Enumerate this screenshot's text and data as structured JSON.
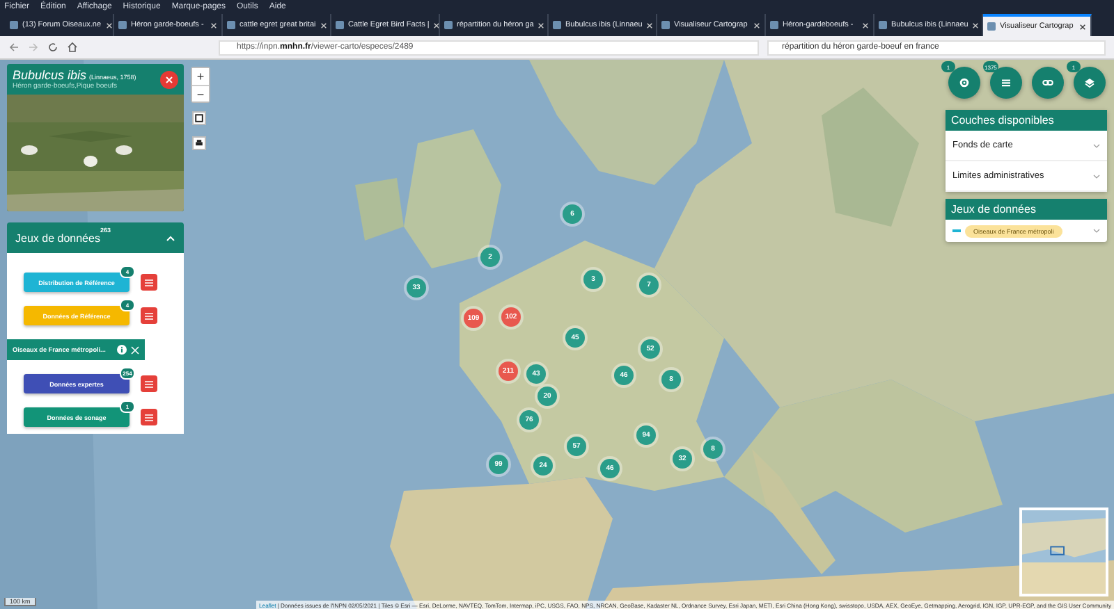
{
  "menu_bar": {
    "items": [
      "Fichier",
      "Édition",
      "Affichage",
      "Historique",
      "Marque-pages",
      "Outils",
      "Aide"
    ]
  },
  "tabs": [
    {
      "title": "(13) Forum Oiseaux.ne",
      "selected": false
    },
    {
      "title": "Héron garde-boeufs - ",
      "selected": false
    },
    {
      "title": "cattle egret great britai",
      "selected": false
    },
    {
      "title": "Cattle Egret Bird Facts |",
      "selected": false
    },
    {
      "title": "répartition du héron ga",
      "selected": false
    },
    {
      "title": "Bubulcus ibis (Linnaeu",
      "selected": false
    },
    {
      "title": "Visualiseur Cartograp",
      "selected": false
    },
    {
      "title": "Héron-gardeboeufs - ",
      "selected": false
    },
    {
      "title": "Bubulcus ibis (Linnaeu",
      "selected": false
    },
    {
      "title": "Visualiseur Cartograp",
      "selected": true
    }
  ],
  "toolbar": {
    "url": "https://inpn.**mnhn.fr**/viewer-carto/especes/2489",
    "search": "répartition du héron garde-boeuf en france"
  },
  "species_card": {
    "name": "Bubulcus ibis",
    "author": "(Linnaeus, 1758)",
    "common_names": "Héron garde-boeufs,Pique boeufs"
  },
  "datasets_panel": {
    "title": "Jeux de données",
    "count": "263",
    "expanded": true,
    "items": [
      {
        "kind": "button",
        "label": "Distribution de Référence",
        "color": "#1eb4d4",
        "count": "4"
      },
      {
        "kind": "button",
        "label": "Données de Référence",
        "color": "#f5b800",
        "count": "4"
      },
      {
        "kind": "active",
        "label": "Oiseaux de France métropoli...",
        "color": "#138a74"
      },
      {
        "kind": "button",
        "label": "Données expertes",
        "color": "#3f4fb5",
        "count": "254"
      },
      {
        "kind": "button",
        "label": "Données de sonage",
        "color": "#129478",
        "count": "1"
      }
    ]
  },
  "map": {
    "zoom_in": "+",
    "zoom_out": "−",
    "scale": "100 km",
    "attribution_link": "Leaflet",
    "attribution": "| Données issues de l'INPN 02/05/2021 | Tiles © Esri — Esri, DeLorme, NAVTEQ, TomTom, Intermap, iPC, USGS, FAO, NPS, NRCAN, GeoBase, Kadaster NL, Ordnance Survey, Esri Japan, METI, Esri China (Hong Kong), swisstopo, USDA, AEX, GeoEye, Getmapping, Aerogrid, IGN, IGP, UPR-EGP, and the GIS User Community",
    "clusters": [
      {
        "count": "6",
        "color": "#2a9d8a"
      },
      {
        "count": "2",
        "color": "#2a9d8a"
      },
      {
        "count": "33",
        "color": "#2a9d8a"
      },
      {
        "count": "3",
        "color": "#2a9d8a"
      },
      {
        "count": "7",
        "color": "#2a9d8a"
      },
      {
        "count": "109",
        "color": "#e8584e"
      },
      {
        "count": "102",
        "color": "#e8584e"
      },
      {
        "count": "45",
        "color": "#2a9d8a"
      },
      {
        "count": "52",
        "color": "#2a9d8a"
      },
      {
        "count": "211",
        "color": "#e8584e"
      },
      {
        "count": "43",
        "color": "#2a9d8a"
      },
      {
        "count": "46",
        "color": "#2a9d8a"
      },
      {
        "count": "8",
        "color": "#2a9d8a"
      },
      {
        "count": "20",
        "color": "#2a9d8a"
      },
      {
        "count": "76",
        "color": "#2a9d8a"
      },
      {
        "count": "94",
        "color": "#2a9d8a"
      },
      {
        "count": "57",
        "color": "#2a9d8a"
      },
      {
        "count": "99",
        "color": "#2a9d8a"
      },
      {
        "count": "24",
        "color": "#2a9d8a"
      },
      {
        "count": "46",
        "color": "#2a9d8a"
      },
      {
        "count": "32",
        "color": "#2a9d8a"
      },
      {
        "count": "8",
        "color": "#2a9d8a"
      }
    ]
  },
  "map_buttons": [
    {
      "kind": "settings",
      "badge": "1"
    },
    {
      "kind": "list",
      "badge": "1375"
    },
    {
      "kind": "link"
    },
    {
      "kind": "layers",
      "badge": "1"
    }
  ],
  "layers_panel": {
    "title": "Couches disponibles",
    "items": [
      "Fonds de carte",
      "Limites administratives"
    ]
  },
  "data_panel": {
    "title": "Jeux de données",
    "chip": "Oiseaux de France métropoli"
  }
}
